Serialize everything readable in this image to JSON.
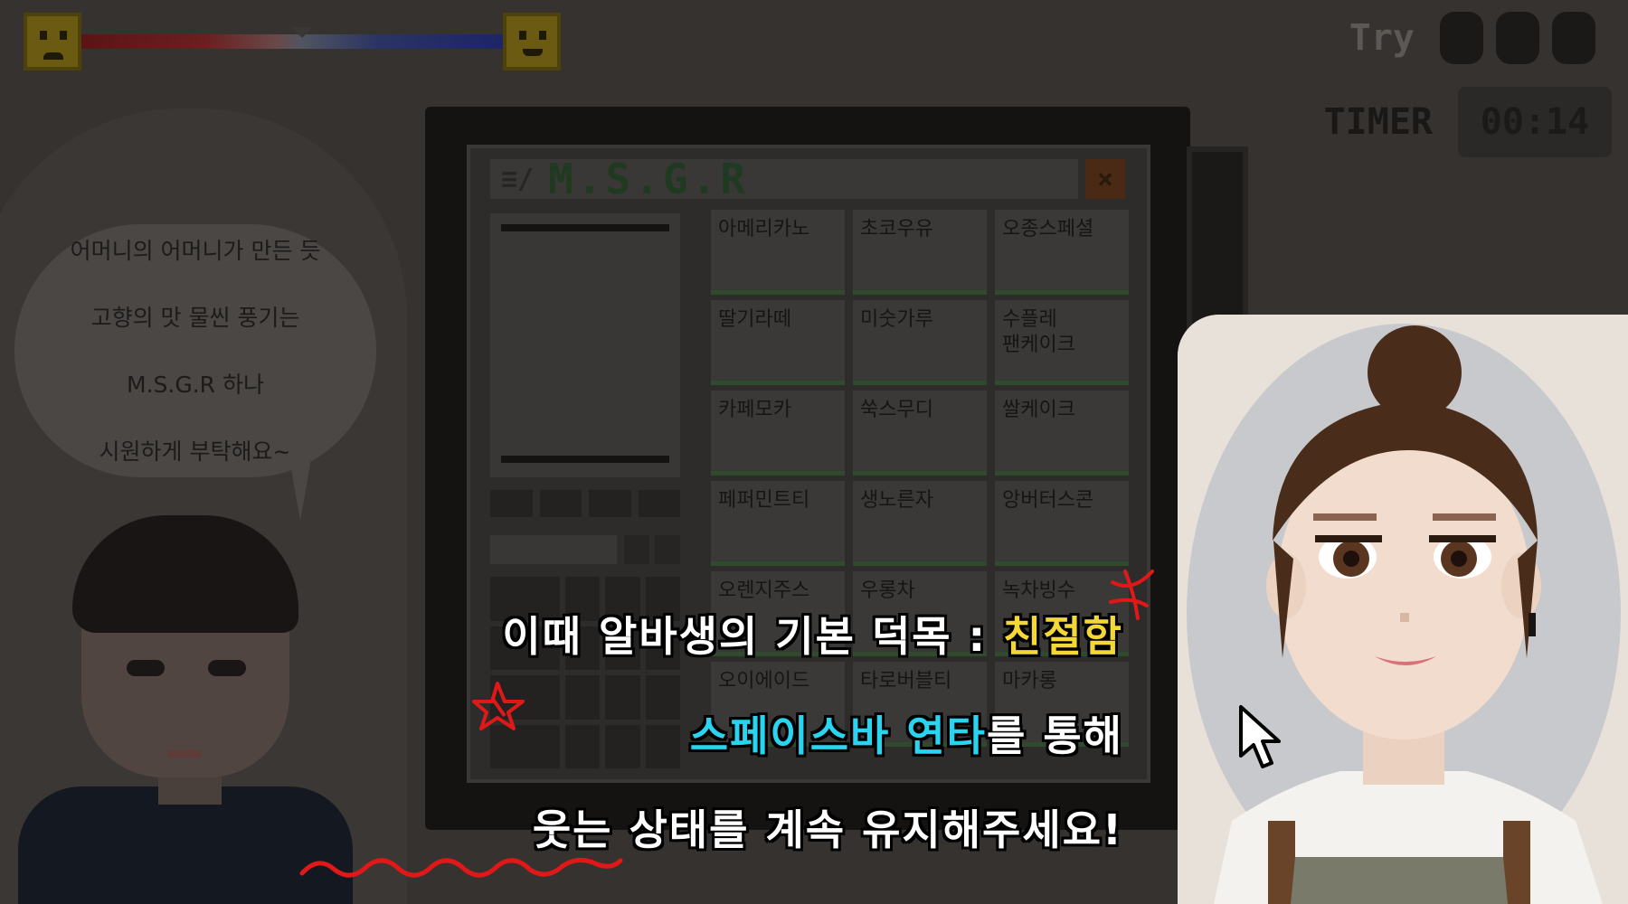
{
  "hud": {
    "mood_icons": {
      "left": "sad-face-icon",
      "right": "happy-face-icon"
    },
    "try_label": "Try",
    "tries_remaining": 3,
    "timer_label": "TIMER",
    "timer_value": "00:14"
  },
  "customer": {
    "speech_lines": [
      "어머니의 어머니가 만든 듯",
      "고향의 맛 물씬 풍기는",
      "M.S.G.R 하나",
      "시원하게 부탁해요~"
    ]
  },
  "pos": {
    "logo": "M.S.G.R",
    "menu": [
      "아메리카노",
      "초코우유",
      "오종스페셜",
      "딸기라떼",
      "미숫가루",
      "수플레\n팬케이크",
      "카페모카",
      "쑥스무디",
      "쌀케이크",
      "페퍼민트티",
      "생노른자",
      "앙버터스콘",
      "오렌지주스",
      "우롱차",
      "녹차빙수",
      "오이에이드",
      "타로버블티",
      "마카롱"
    ]
  },
  "tutorial": {
    "line1_prefix": "이때 알바생의 기본 덕목 : ",
    "line1_highlight": "친절함",
    "line2_highlight": "스페이스바 연타",
    "line2_suffix": "를 통해",
    "line3": "웃는 상태를 계속 유지해주세요!"
  },
  "colors": {
    "highlight_yellow": "#f2d735",
    "highlight_cyan": "#2ad3ef",
    "annotation_red": "#e01818"
  }
}
